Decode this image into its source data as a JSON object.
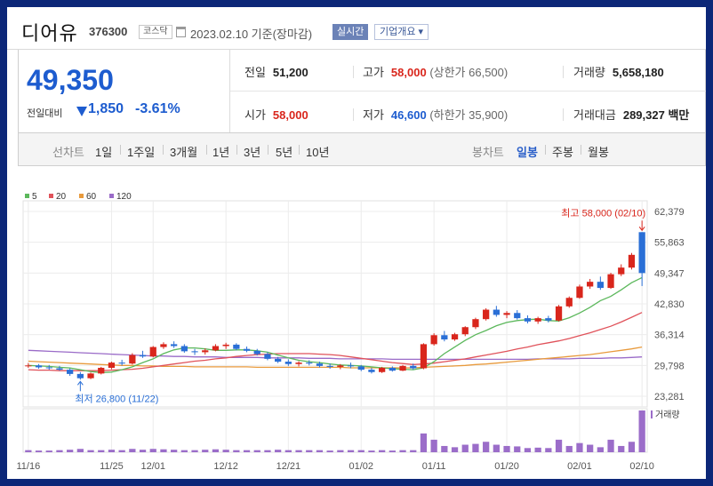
{
  "header": {
    "stock_name": "디어유",
    "code": "376300",
    "market": "코스닥",
    "date": "2023.02.10 기준(장마감)",
    "live_button": "실시간",
    "company_button": "기업개요 ▾",
    "calendar_icon": "calendar-icon"
  },
  "summary": {
    "price": "49,350",
    "change_label": "전일대비",
    "change_value": "1,850",
    "change_pct": "-3.61%",
    "direction_icon": "down-triangle-icon",
    "colors": {
      "up": "#d9261c",
      "down": "#1d5ccf"
    },
    "prev_close": {
      "label": "전일",
      "value": "51,200"
    },
    "high": {
      "label": "고가",
      "value": "58,000",
      "sub": "(상한가 66,500)"
    },
    "volume": {
      "label": "거래량",
      "value": "5,658,180"
    },
    "open": {
      "label": "시가",
      "value": "58,000"
    },
    "low": {
      "label": "저가",
      "value": "46,600",
      "sub": "(하한가 35,900)"
    },
    "amount": {
      "label": "거래대금",
      "value": "289,327",
      "unit": "백만"
    }
  },
  "tabs": {
    "line_chart": "선차트",
    "periods": [
      "1일",
      "1주일",
      "3개월",
      "1년",
      "3년",
      "5년",
      "10년"
    ],
    "candle_chart": "봉차트",
    "candle_periods": [
      "일봉",
      "주봉",
      "월봉"
    ],
    "active_candle": "일봉"
  },
  "chart_data": {
    "type": "candlestick",
    "legend": [
      {
        "label": "5",
        "color": "#5cb85c"
      },
      {
        "label": "20",
        "color": "#e0525a"
      },
      {
        "label": "60",
        "color": "#e89a3c"
      },
      {
        "label": "120",
        "color": "#9a6bc8"
      }
    ],
    "y_ticks": [
      "62,379",
      "55,863",
      "49,347",
      "42,830",
      "36,314",
      "29,798",
      "23,281"
    ],
    "ylim": [
      23281,
      62379
    ],
    "x_ticks": [
      "11/16",
      "11/25",
      "12/01",
      "12/12",
      "12/21",
      "01/02",
      "01/11",
      "01/20",
      "02/01",
      "02/10"
    ],
    "x_tick_index": [
      0,
      8,
      12,
      19,
      25,
      32,
      39,
      46,
      53,
      59
    ],
    "high_annotation": "최고 58,000 (02/10)",
    "low_annotation": "최저 26,800 (11/22)",
    "volume_label": "거래량",
    "colors": {
      "up": "#d9261c",
      "down": "#2a6fd6"
    },
    "ohlc": [
      [
        29700,
        30300,
        29300,
        29800
      ],
      [
        29800,
        30100,
        29100,
        29400
      ],
      [
        29400,
        29900,
        28900,
        29200
      ],
      [
        29200,
        29700,
        28700,
        28900
      ],
      [
        28900,
        29200,
        27600,
        28000
      ],
      [
        28000,
        28400,
        26800,
        27100
      ],
      [
        27100,
        28300,
        26900,
        28100
      ],
      [
        28100,
        29500,
        27900,
        29300
      ],
      [
        29300,
        30600,
        29000,
        30400
      ],
      [
        30400,
        31000,
        29800,
        30200
      ],
      [
        30200,
        32400,
        30000,
        32000
      ],
      [
        32000,
        32900,
        31400,
        31700
      ],
      [
        31700,
        33900,
        31500,
        33700
      ],
      [
        33700,
        34700,
        33300,
        34300
      ],
      [
        34300,
        34900,
        33500,
        33900
      ],
      [
        33900,
        34300,
        32500,
        32800
      ],
      [
        32800,
        33300,
        32000,
        32600
      ],
      [
        32600,
        33400,
        32100,
        33000
      ],
      [
        33000,
        34300,
        32800,
        33900
      ],
      [
        33900,
        34600,
        33300,
        34200
      ],
      [
        34200,
        34500,
        33000,
        33300
      ],
      [
        33300,
        33800,
        32600,
        32900
      ],
      [
        32900,
        33300,
        31900,
        32200
      ],
      [
        32200,
        32600,
        30900,
        31200
      ],
      [
        31200,
        31600,
        30300,
        30600
      ],
      [
        30600,
        31100,
        29700,
        30100
      ],
      [
        30100,
        30700,
        29600,
        30400
      ],
      [
        30400,
        30900,
        29800,
        30200
      ],
      [
        30200,
        30600,
        29400,
        29700
      ],
      [
        29700,
        30200,
        29100,
        29500
      ],
      [
        29500,
        30100,
        29000,
        29800
      ],
      [
        29800,
        30400,
        29200,
        29600
      ],
      [
        29600,
        29900,
        28600,
        28900
      ],
      [
        28900,
        29300,
        28100,
        28400
      ],
      [
        28400,
        29500,
        28200,
        29300
      ],
      [
        29300,
        29600,
        28500,
        28700
      ],
      [
        28700,
        29900,
        28600,
        29700
      ],
      [
        29700,
        30200,
        28900,
        29200
      ],
      [
        29200,
        34500,
        29000,
        34300
      ],
      [
        34300,
        36600,
        34000,
        36200
      ],
      [
        36200,
        37100,
        34900,
        35300
      ],
      [
        35300,
        36700,
        35000,
        36400
      ],
      [
        36400,
        38100,
        36000,
        37900
      ],
      [
        37900,
        39900,
        37500,
        39600
      ],
      [
        39600,
        41900,
        39300,
        41600
      ],
      [
        41600,
        42400,
        40100,
        40500
      ],
      [
        40500,
        41300,
        39800,
        40900
      ],
      [
        40900,
        41500,
        39500,
        39800
      ],
      [
        39800,
        40400,
        38700,
        39100
      ],
      [
        39100,
        40100,
        38600,
        39800
      ],
      [
        39800,
        40300,
        38900,
        39300
      ],
      [
        39300,
        42600,
        39100,
        42300
      ],
      [
        42300,
        44400,
        42000,
        44100
      ],
      [
        44100,
        46900,
        43900,
        46500
      ],
      [
        46500,
        48100,
        46000,
        47500
      ],
      [
        47500,
        48600,
        45800,
        46200
      ],
      [
        46200,
        49400,
        46000,
        49100
      ],
      [
        49100,
        51200,
        48700,
        50500
      ],
      [
        50500,
        53600,
        50100,
        53200
      ],
      [
        58000,
        58000,
        46600,
        49350
      ]
    ],
    "volume": [
      0.05,
      0.04,
      0.04,
      0.05,
      0.06,
      0.08,
      0.05,
      0.05,
      0.06,
      0.05,
      0.08,
      0.06,
      0.08,
      0.07,
      0.06,
      0.05,
      0.05,
      0.06,
      0.07,
      0.06,
      0.05,
      0.05,
      0.05,
      0.05,
      0.06,
      0.05,
      0.05,
      0.05,
      0.05,
      0.04,
      0.05,
      0.05,
      0.05,
      0.04,
      0.05,
      0.04,
      0.05,
      0.05,
      0.45,
      0.3,
      0.15,
      0.12,
      0.18,
      0.2,
      0.25,
      0.18,
      0.15,
      0.14,
      0.1,
      0.11,
      0.1,
      0.3,
      0.15,
      0.22,
      0.18,
      0.12,
      0.3,
      0.15,
      0.25,
      1.0
    ],
    "ma5": [
      29800,
      29700,
      29600,
      29400,
      29250,
      28900,
      28500,
      28300,
      28400,
      28900,
      29500,
      30400,
      31200,
      32300,
      33100,
      33500,
      33500,
      33300,
      33000,
      33000,
      33100,
      33100,
      32900,
      32600,
      32000,
      31400,
      30900,
      30600,
      30400,
      30100,
      29900,
      29800,
      29700,
      29500,
      29300,
      29100,
      29000,
      28900,
      29300,
      30600,
      32300,
      33700,
      35100,
      36300,
      37200,
      38200,
      38900,
      39300,
      39500,
      39600,
      39300,
      39200,
      39900,
      40900,
      42100,
      43500,
      44400,
      45800,
      47300,
      48400
    ],
    "ma20": [
      28900,
      28800,
      28800,
      28700,
      28700,
      28700,
      28700,
      28700,
      28800,
      28900,
      29000,
      29200,
      29500,
      29800,
      30100,
      30400,
      30700,
      30900,
      31200,
      31400,
      31700,
      31900,
      32100,
      32200,
      32300,
      32300,
      32300,
      32300,
      32200,
      32100,
      31900,
      31600,
      31300,
      31000,
      30700,
      30400,
      30200,
      30000,
      30100,
      30300,
      30600,
      30900,
      31200,
      31600,
      32000,
      32400,
      32800,
      33300,
      33700,
      34200,
      34600,
      35000,
      35500,
      36100,
      36700,
      37400,
      38100,
      39000,
      40000,
      41000
    ],
    "ma60": [
      30700,
      30600,
      30500,
      30400,
      30300,
      30200,
      30100,
      30000,
      29900,
      29800,
      29800,
      29700,
      29700,
      29600,
      29600,
      29600,
      29500,
      29500,
      29500,
      29500,
      29500,
      29500,
      29400,
      29400,
      29400,
      29400,
      29400,
      29400,
      29400,
      29400,
      29400,
      29300,
      29300,
      29300,
      29300,
      29300,
      29300,
      29300,
      29400,
      29500,
      29600,
      29700,
      29800,
      30000,
      30100,
      30300,
      30500,
      30700,
      30900,
      31100,
      31300,
      31500,
      31700,
      31900,
      32100,
      32400,
      32700,
      33000,
      33300,
      33700
    ],
    "ma120": [
      33000,
      32900,
      32800,
      32700,
      32600,
      32500,
      32400,
      32300,
      32200,
      32100,
      32000,
      31900,
      31800,
      31800,
      31700,
      31700,
      31600,
      31600,
      31600,
      31500,
      31500,
      31500,
      31500,
      31400,
      31400,
      31400,
      31400,
      31300,
      31300,
      31300,
      31200,
      31200,
      31200,
      31200,
      31200,
      31100,
      31100,
      31100,
      31100,
      31100,
      31100,
      31100,
      31100,
      31100,
      31100,
      31100,
      31100,
      31100,
      31100,
      31200,
      31200,
      31200,
      31200,
      31300,
      31300,
      31300,
      31400,
      31400,
      31500,
      31600
    ]
  }
}
